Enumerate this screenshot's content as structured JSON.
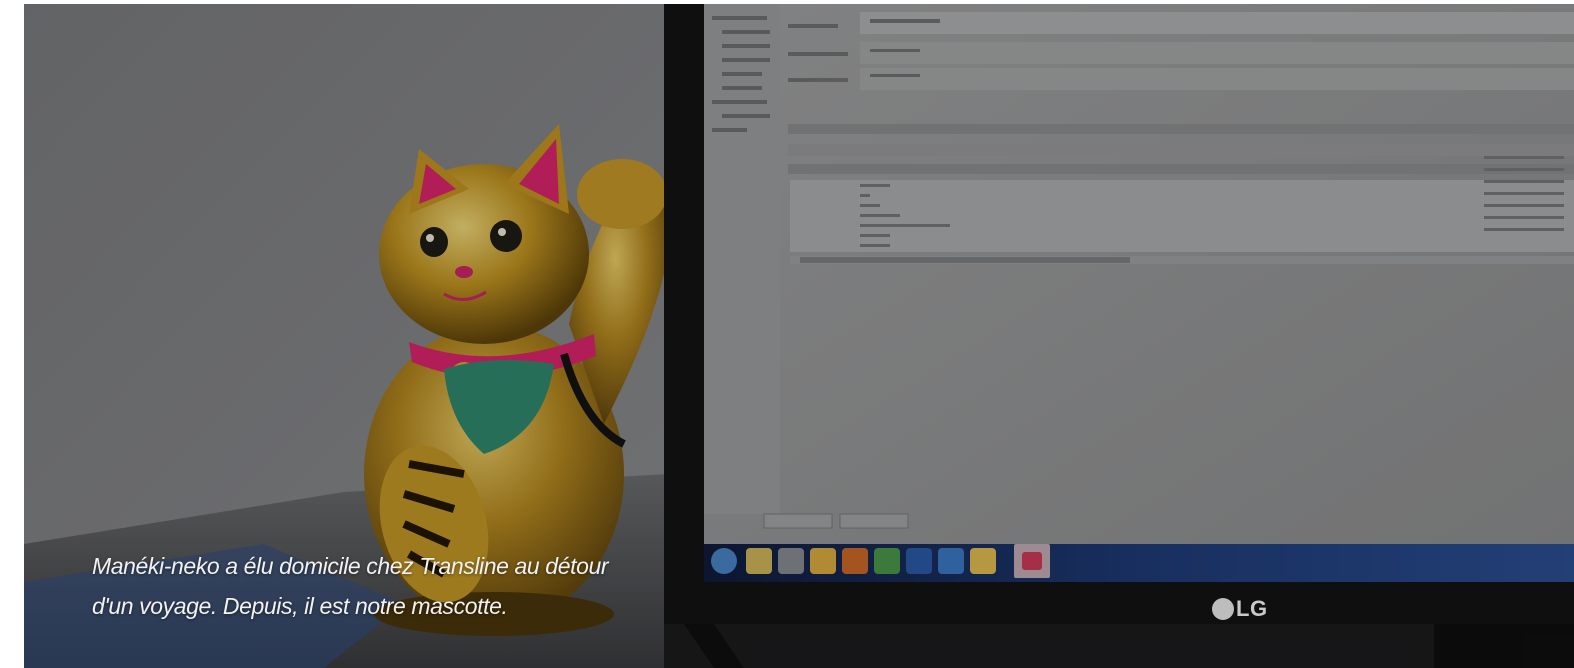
{
  "photo": {
    "alt_subject": "maneki-neko-figurine-and-monitor",
    "caption_lines": [
      "Manéki-neko a élu domicile chez Transline au détour",
      "d'un voyage. Depuis, il est notre mascotte."
    ],
    "monitor_brand": "LG"
  },
  "colors": {
    "caption_text": "#f2f2f2",
    "wall": "#8a8a8a",
    "gold": "#c9a227",
    "pink": "#e0246e",
    "screen_bg": "#9a9b9c",
    "taskbar": "#1d3a78"
  }
}
